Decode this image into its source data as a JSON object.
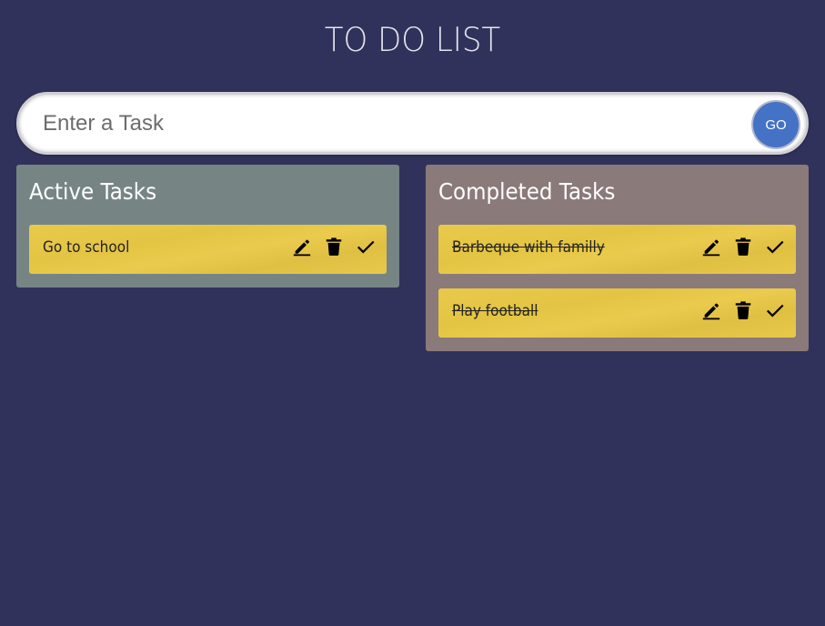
{
  "header": {
    "title": "TO DO LIST"
  },
  "search": {
    "placeholder": "Enter a Task",
    "value": "",
    "go_label": "GO"
  },
  "active": {
    "heading": "Active Tasks",
    "tasks": [
      {
        "text": "Go to school"
      }
    ]
  },
  "completed": {
    "heading": "Completed Tasks",
    "tasks": [
      {
        "text": "Barbeque with familly"
      },
      {
        "text": "Play football"
      }
    ]
  },
  "icons": {
    "edit": "pencil-icon",
    "delete": "trash-icon",
    "complete": "check-icon"
  },
  "colors": {
    "background": "#31325b",
    "active_panel": "#768584",
    "completed_panel": "#8a7a79",
    "task_card": "#e7c748",
    "go_button": "#4472c4"
  }
}
